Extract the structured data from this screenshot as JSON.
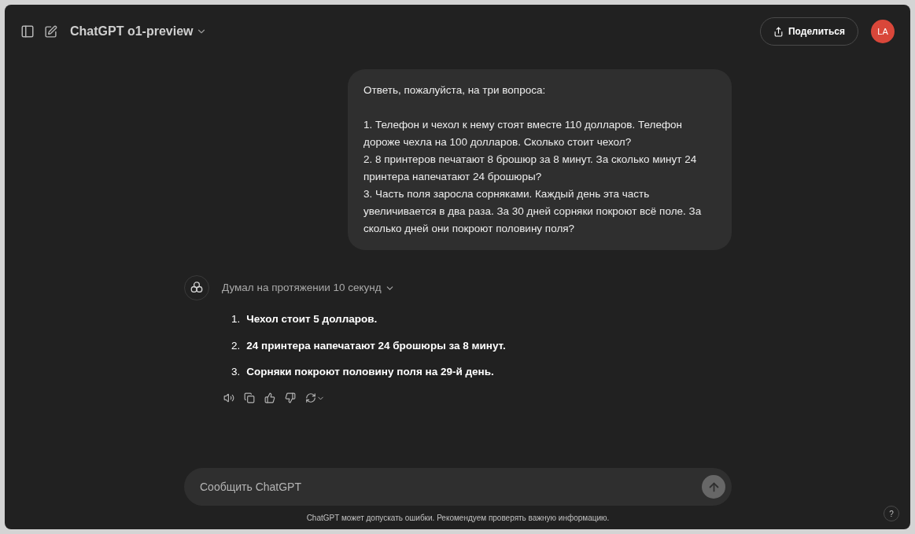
{
  "header": {
    "model": "ChatGPT o1-preview",
    "share_label": "Поделиться",
    "avatar": "LA"
  },
  "user_message": [
    "Ответь, пожалуйста, на три вопроса:",
    "1. Телефон и чехол к нему стоят вместе 110 долларов. Телефон дороже чехла на 100 долларов. Сколько стоит чехол?\n2. 8 принтеров печатают 8 брошюр за 8 минут. За сколько минут 24 принтера напечатают 24 брошюры?\n3. Часть поля заросла сорняками. Каждый день эта часть увеличивается в два раза. За 30 дней сорняки покроют всё поле. За сколько дней они покроют половину поля?"
  ],
  "assistant": {
    "thought": "Думал на протяжении 10 секунд",
    "expanded": false,
    "answers": [
      {
        "number": "1.",
        "text": "Чехол стоит 5 долларов."
      },
      {
        "number": "2.",
        "text": "24 принтера напечатают 24 брошюры за 8 минут."
      },
      {
        "number": "3.",
        "text": "Сорняки покроют половину поля на 29-й день."
      }
    ]
  },
  "composer": {
    "placeholder": "Сообщить ChatGPT"
  },
  "disclaimer": "ChatGPT может допускать ошибки. Рекомендуем проверять важную информацию.",
  "help": "?"
}
